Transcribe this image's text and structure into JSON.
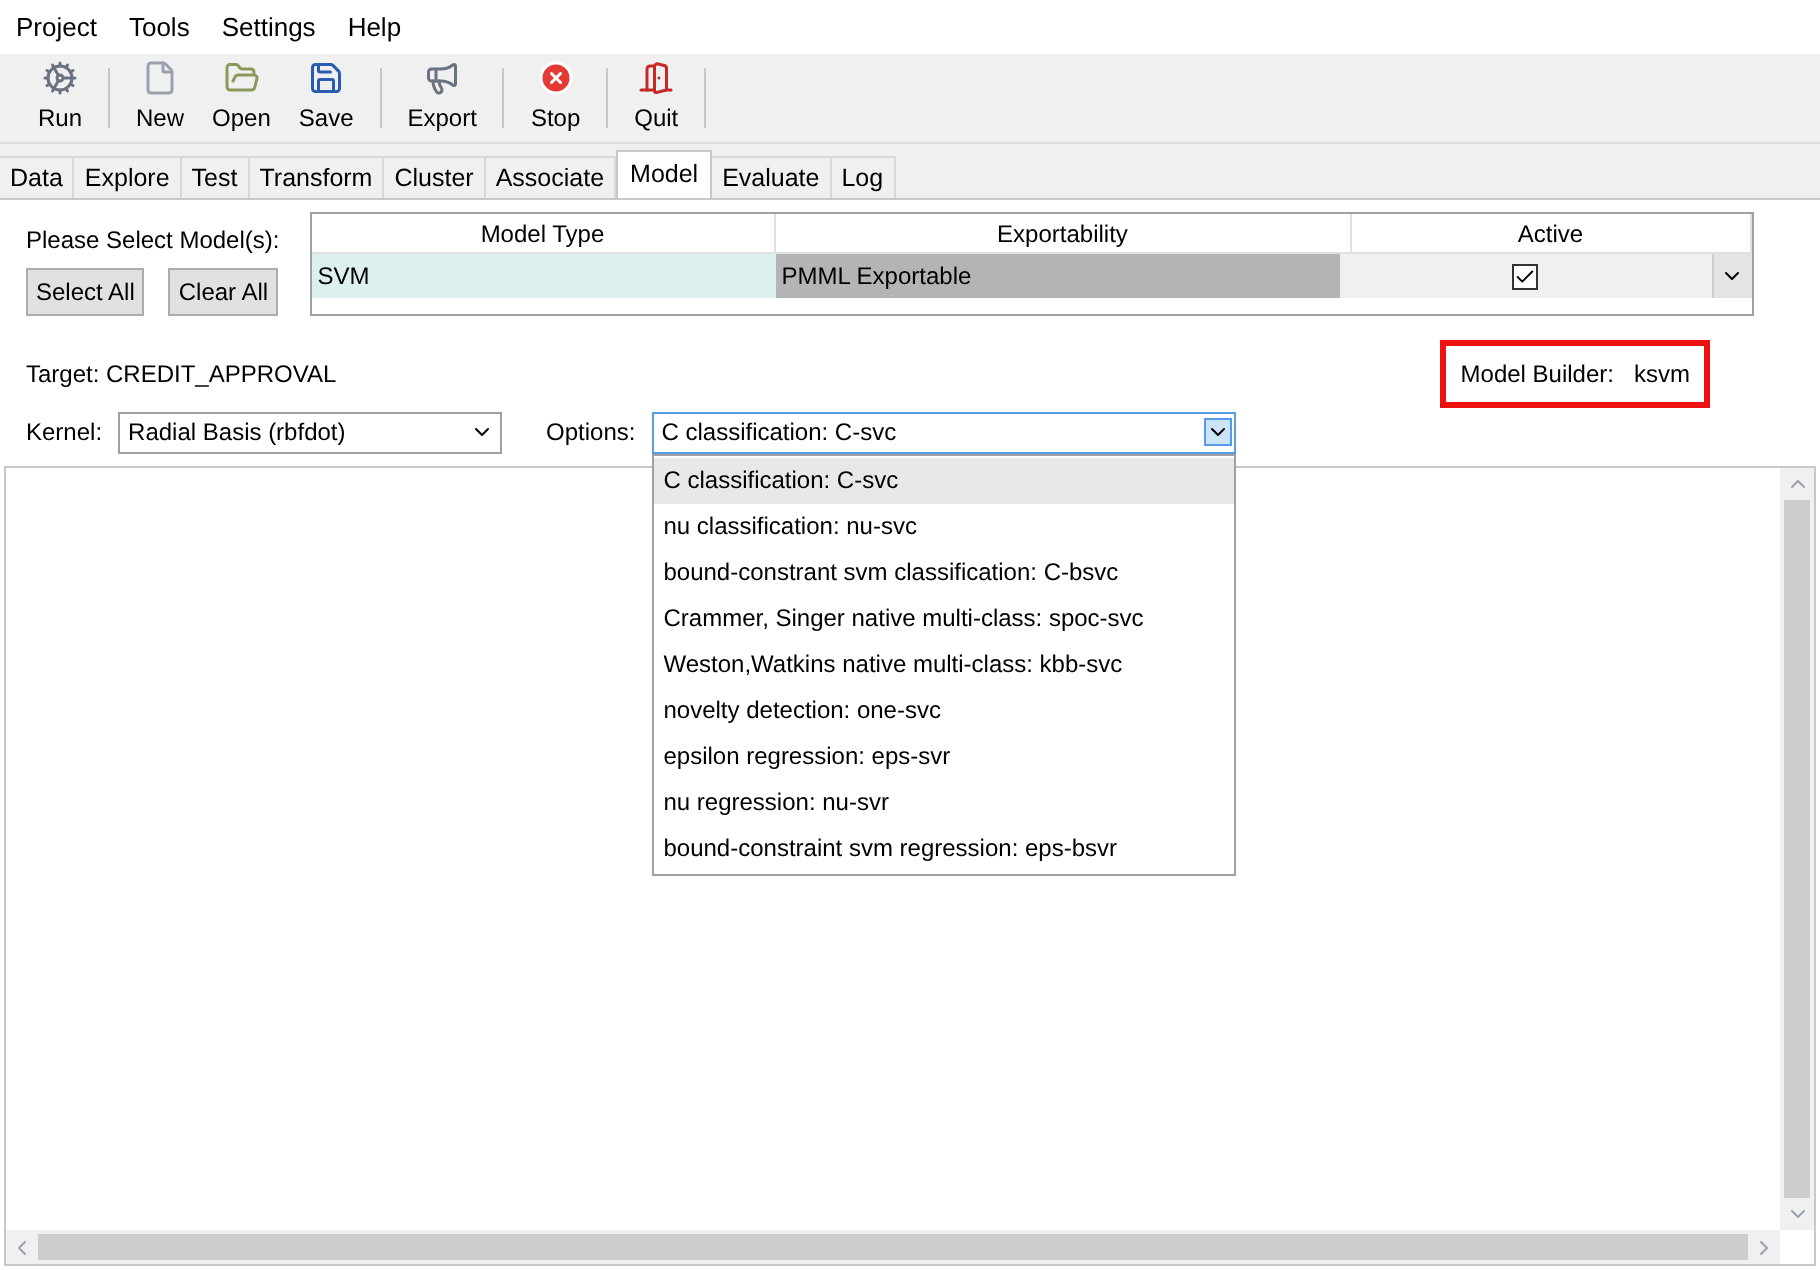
{
  "menu": [
    "Project",
    "Tools",
    "Settings",
    "Help"
  ],
  "toolbar": [
    [
      "Run"
    ],
    [
      "New",
      "Open",
      "Save"
    ],
    [
      "Export"
    ],
    [
      "Stop"
    ],
    [
      "Quit"
    ]
  ],
  "tabs": [
    {
      "label": "Data",
      "selected": false
    },
    {
      "label": "Explore",
      "selected": false
    },
    {
      "label": "Test",
      "selected": false
    },
    {
      "label": "Transform",
      "selected": false
    },
    {
      "label": "Cluster",
      "selected": false
    },
    {
      "label": "Associate",
      "selected": false
    },
    {
      "label": "Model",
      "selected": true
    },
    {
      "label": "Evaluate",
      "selected": false
    },
    {
      "label": "Log",
      "selected": false
    }
  ],
  "model_select": {
    "label": "Please Select Model(s):",
    "buttons": [
      "Select All",
      "Clear All"
    ]
  },
  "models_table": {
    "columns": [
      "Model Type",
      "Exportability",
      "Active"
    ],
    "rows": [
      {
        "model_type": "SVM",
        "exportability": "PMML Exportable",
        "active": true
      }
    ]
  },
  "target": "Target: CREDIT_APPROVAL",
  "model_builder": {
    "label": "Model Builder:",
    "value": "ksvm"
  },
  "kernel": {
    "label": "Kernel:",
    "value": "Radial Basis (rbfdot)"
  },
  "options": {
    "label": "Options:",
    "value": "C classification: C-svc",
    "expanded": true,
    "items": [
      {
        "label": "C classification: C-svc",
        "selected": true
      },
      {
        "label": "nu classification: nu-svc",
        "selected": false
      },
      {
        "label": "bound-constrant svm classification: C-bsvc",
        "selected": false
      },
      {
        "label": "Crammer, Singer native multi-class: spoc-svc",
        "selected": false
      },
      {
        "label": "Weston,Watkins native multi-class: kbb-svc",
        "selected": false
      },
      {
        "label": "novelty detection: one-svc",
        "selected": false
      },
      {
        "label": "epsilon regression: eps-svr",
        "selected": false
      },
      {
        "label": "nu regression: nu-svr",
        "selected": false
      },
      {
        "label": "bound-constraint svm regression: eps-bsvr",
        "selected": false
      }
    ]
  }
}
